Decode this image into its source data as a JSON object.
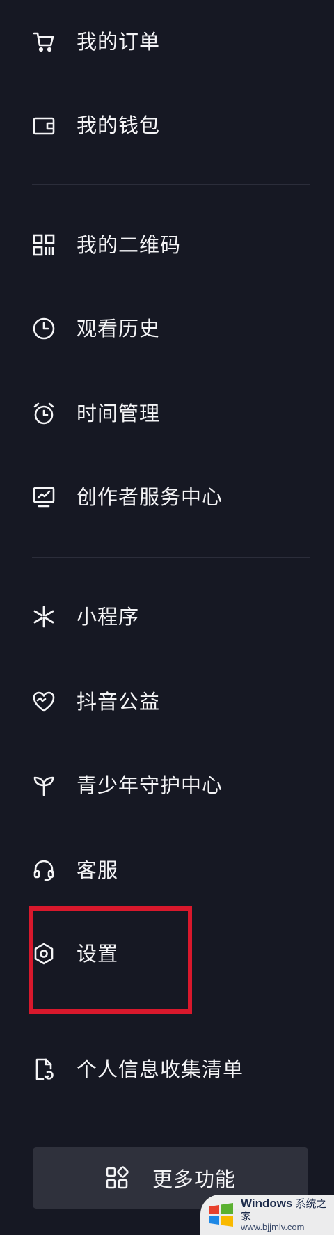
{
  "menu": {
    "orders": "我的订单",
    "wallet": "我的钱包",
    "qrcode": "我的二维码",
    "history": "观看历史",
    "time_management": "时间管理",
    "creator_center": "创作者服务中心",
    "mini_programs": "小程序",
    "charity": "抖音公益",
    "youth_protection": "青少年守护中心",
    "customer_service": "客服",
    "settings": "设置",
    "personal_info": "个人信息收集清单"
  },
  "more_functions": "更多功能",
  "watermark": {
    "brand": "Windows",
    "brand_cn": "系统之家",
    "url": "www.bjjmlv.com"
  },
  "colors": {
    "background": "#161823",
    "text": "#f4f4f6",
    "divider": "#2b2d3a",
    "highlight": "#d8182c",
    "button_bg": "#2f313c"
  }
}
